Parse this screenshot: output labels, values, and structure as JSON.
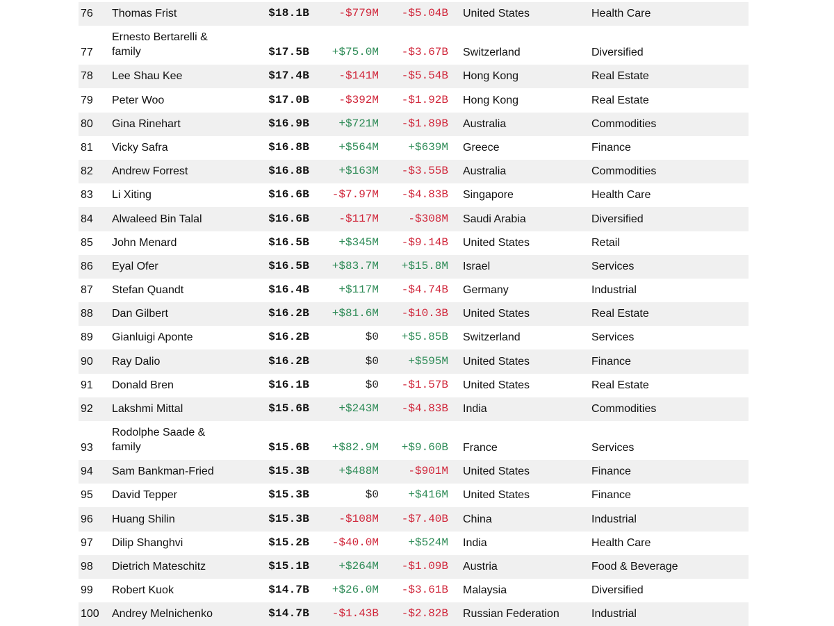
{
  "colors": {
    "positive": "#2e8b57",
    "negative": "#d0263a",
    "row_shade": "#f0f0f0"
  },
  "rows": [
    {
      "rank": "76",
      "name": "Thomas Frist",
      "net_worth": "$18.1B",
      "last_change": "-$779M",
      "ytd_change": "-$5.04B",
      "country": "United States",
      "industry": "Health Care"
    },
    {
      "rank": "77",
      "name": "Ernesto Bertarelli & family",
      "net_worth": "$17.5B",
      "last_change": "+$75.0M",
      "ytd_change": "-$3.67B",
      "country": "Switzerland",
      "industry": "Diversified"
    },
    {
      "rank": "78",
      "name": "Lee Shau Kee",
      "net_worth": "$17.4B",
      "last_change": "-$141M",
      "ytd_change": "-$5.54B",
      "country": "Hong Kong",
      "industry": "Real Estate"
    },
    {
      "rank": "79",
      "name": "Peter Woo",
      "net_worth": "$17.0B",
      "last_change": "-$392M",
      "ytd_change": "-$1.92B",
      "country": "Hong Kong",
      "industry": "Real Estate"
    },
    {
      "rank": "80",
      "name": "Gina Rinehart",
      "net_worth": "$16.9B",
      "last_change": "+$721M",
      "ytd_change": "-$1.89B",
      "country": "Australia",
      "industry": "Commodities"
    },
    {
      "rank": "81",
      "name": "Vicky Safra",
      "net_worth": "$16.8B",
      "last_change": "+$564M",
      "ytd_change": "+$639M",
      "country": "Greece",
      "industry": "Finance"
    },
    {
      "rank": "82",
      "name": "Andrew Forrest",
      "net_worth": "$16.8B",
      "last_change": "+$163M",
      "ytd_change": "-$3.55B",
      "country": "Australia",
      "industry": "Commodities"
    },
    {
      "rank": "83",
      "name": "Li Xiting",
      "net_worth": "$16.6B",
      "last_change": "-$7.97M",
      "ytd_change": "-$4.83B",
      "country": "Singapore",
      "industry": "Health Care"
    },
    {
      "rank": "84",
      "name": "Alwaleed Bin Talal",
      "net_worth": "$16.6B",
      "last_change": "-$117M",
      "ytd_change": "-$308M",
      "country": "Saudi Arabia",
      "industry": "Diversified"
    },
    {
      "rank": "85",
      "name": "John Menard",
      "net_worth": "$16.5B",
      "last_change": "+$345M",
      "ytd_change": "-$9.14B",
      "country": "United States",
      "industry": "Retail"
    },
    {
      "rank": "86",
      "name": "Eyal Ofer",
      "net_worth": "$16.5B",
      "last_change": "+$83.7M",
      "ytd_change": "+$15.8M",
      "country": "Israel",
      "industry": "Services"
    },
    {
      "rank": "87",
      "name": "Stefan Quandt",
      "net_worth": "$16.4B",
      "last_change": "+$117M",
      "ytd_change": "-$4.74B",
      "country": "Germany",
      "industry": "Industrial"
    },
    {
      "rank": "88",
      "name": "Dan Gilbert",
      "net_worth": "$16.2B",
      "last_change": "+$81.6M",
      "ytd_change": "-$10.3B",
      "country": "United States",
      "industry": "Real Estate"
    },
    {
      "rank": "89",
      "name": "Gianluigi Aponte",
      "net_worth": "$16.2B",
      "last_change": "$0",
      "ytd_change": "+$5.85B",
      "country": "Switzerland",
      "industry": "Services"
    },
    {
      "rank": "90",
      "name": "Ray Dalio",
      "net_worth": "$16.2B",
      "last_change": "$0",
      "ytd_change": "+$595M",
      "country": "United States",
      "industry": "Finance"
    },
    {
      "rank": "91",
      "name": "Donald Bren",
      "net_worth": "$16.1B",
      "last_change": "$0",
      "ytd_change": "-$1.57B",
      "country": "United States",
      "industry": "Real Estate"
    },
    {
      "rank": "92",
      "name": "Lakshmi Mittal",
      "net_worth": "$15.6B",
      "last_change": "+$243M",
      "ytd_change": "-$4.83B",
      "country": "India",
      "industry": "Commodities"
    },
    {
      "rank": "93",
      "name": "Rodolphe Saade & family",
      "net_worth": "$15.6B",
      "last_change": "+$82.9M",
      "ytd_change": "+$9.60B",
      "country": "France",
      "industry": "Services"
    },
    {
      "rank": "94",
      "name": "Sam Bankman-Fried",
      "net_worth": "$15.3B",
      "last_change": "+$488M",
      "ytd_change": "-$901M",
      "country": "United States",
      "industry": "Finance"
    },
    {
      "rank": "95",
      "name": "David Tepper",
      "net_worth": "$15.3B",
      "last_change": "$0",
      "ytd_change": "+$416M",
      "country": "United States",
      "industry": "Finance"
    },
    {
      "rank": "96",
      "name": "Huang Shilin",
      "net_worth": "$15.3B",
      "last_change": "-$108M",
      "ytd_change": "-$7.40B",
      "country": "China",
      "industry": "Industrial"
    },
    {
      "rank": "97",
      "name": "Dilip Shanghvi",
      "net_worth": "$15.2B",
      "last_change": "-$40.0M",
      "ytd_change": "+$524M",
      "country": "India",
      "industry": "Health Care"
    },
    {
      "rank": "98",
      "name": "Dietrich Mateschitz",
      "net_worth": "$15.1B",
      "last_change": "+$264M",
      "ytd_change": "-$1.09B",
      "country": "Austria",
      "industry": "Food & Beverage"
    },
    {
      "rank": "99",
      "name": "Robert Kuok",
      "net_worth": "$14.7B",
      "last_change": "+$26.0M",
      "ytd_change": "-$3.61B",
      "country": "Malaysia",
      "industry": "Diversified"
    },
    {
      "rank": "100",
      "name": "Andrey Melnichenko",
      "net_worth": "$14.7B",
      "last_change": "-$1.43B",
      "ytd_change": "-$2.82B",
      "country": "Russian Federation",
      "industry": "Industrial"
    }
  ]
}
